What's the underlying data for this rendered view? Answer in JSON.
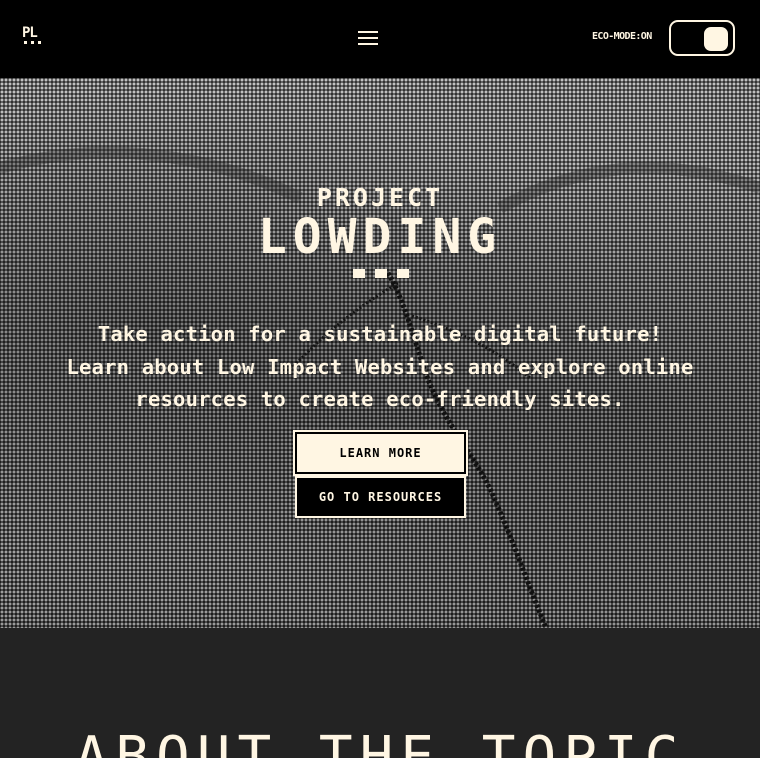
{
  "header": {
    "logo_text": "PL",
    "menu_icon": "hamburger-menu-icon",
    "eco_mode_label": "ECO-MODE:ON"
  },
  "hero": {
    "kicker": "PROJECT",
    "title": "LOWDING",
    "description_lines": [
      "Take action for a sustainable digital future!",
      "Learn about Low Impact Websites and explore online",
      "resources to create eco-friendly sites."
    ],
    "buttons": {
      "learn_more": "LEARN MORE",
      "go_to_resources": "GO TO RESOURCES"
    }
  },
  "about": {
    "heading": "ABOUT THE TOPIC"
  },
  "colors": {
    "cream": "#fff6e3",
    "black": "#000000",
    "section_dark": "#232323"
  }
}
